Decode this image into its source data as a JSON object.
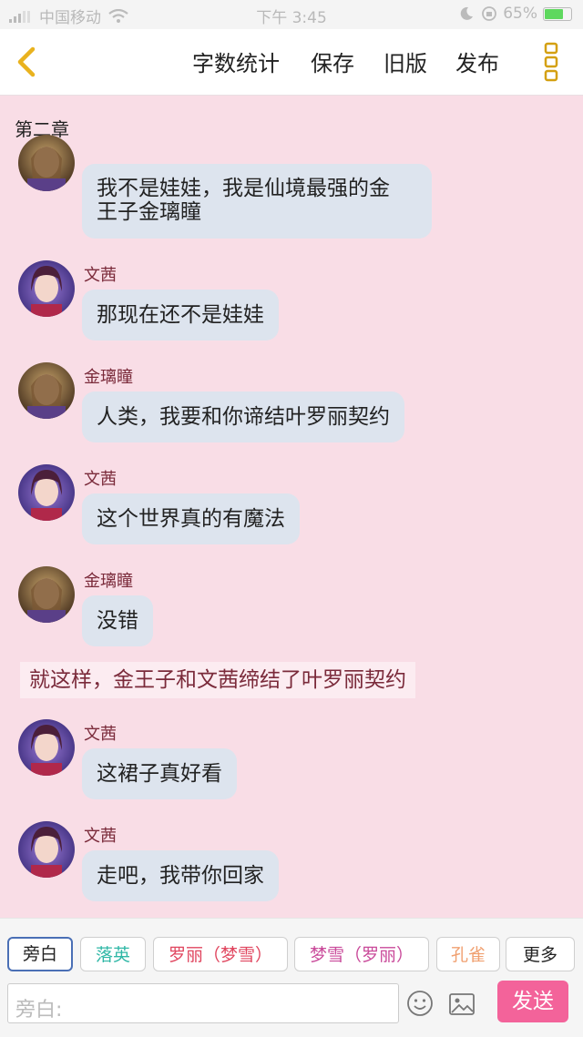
{
  "status_bar": {
    "carrier": "中国移动",
    "time": "下午 3:45",
    "battery": "65%",
    "battery_level": 0.65
  },
  "nav": {
    "word_count": "字数统计",
    "save": "保存",
    "old_version": "旧版",
    "publish": "发布"
  },
  "chapter_title": "第二章",
  "messages": [
    {
      "speaker": "",
      "text_line1": "我不是娃娃，我是仙境最强的金",
      "text_line2": "王子金璃瞳",
      "avatar": "prince-avatar"
    },
    {
      "speaker": "文茜",
      "text": "那现在还不是娃娃",
      "avatar": "wenqian-avatar"
    },
    {
      "speaker": "金璃瞳",
      "text": "人类，我要和你谛结叶罗丽契约",
      "avatar": "prince-avatar"
    },
    {
      "speaker": "文茜",
      "text": "这个世界真的有魔法",
      "avatar": "wenqian-avatar"
    },
    {
      "speaker": "金璃瞳",
      "text": "没错",
      "avatar": "prince-avatar"
    },
    {
      "speaker": "文茜",
      "text": "这裙子真好看",
      "avatar": "wenqian-avatar"
    },
    {
      "speaker": "文茜",
      "text": "走吧，我带你回家",
      "avatar": "wenqian-avatar"
    }
  ],
  "narration": "就这样，金王子和文茜缔结了叶罗丽契约",
  "roles": [
    {
      "label": "旁白",
      "color": "#222222"
    },
    {
      "label": "落英",
      "color": "#2fb7a6"
    },
    {
      "label": "罗丽（梦雪）",
      "color": "#e0465f"
    },
    {
      "label": "梦雪（罗丽）",
      "color": "#c94a9a"
    },
    {
      "label": "孔雀",
      "color": "#f0a070"
    },
    {
      "label": "更多",
      "color": "#222222"
    }
  ],
  "input": {
    "placeholder": "旁白:"
  },
  "send_label": "发送",
  "colors": {
    "accent": "#f3639a",
    "bubble": "#dde4ee",
    "background": "#f9dde6"
  }
}
